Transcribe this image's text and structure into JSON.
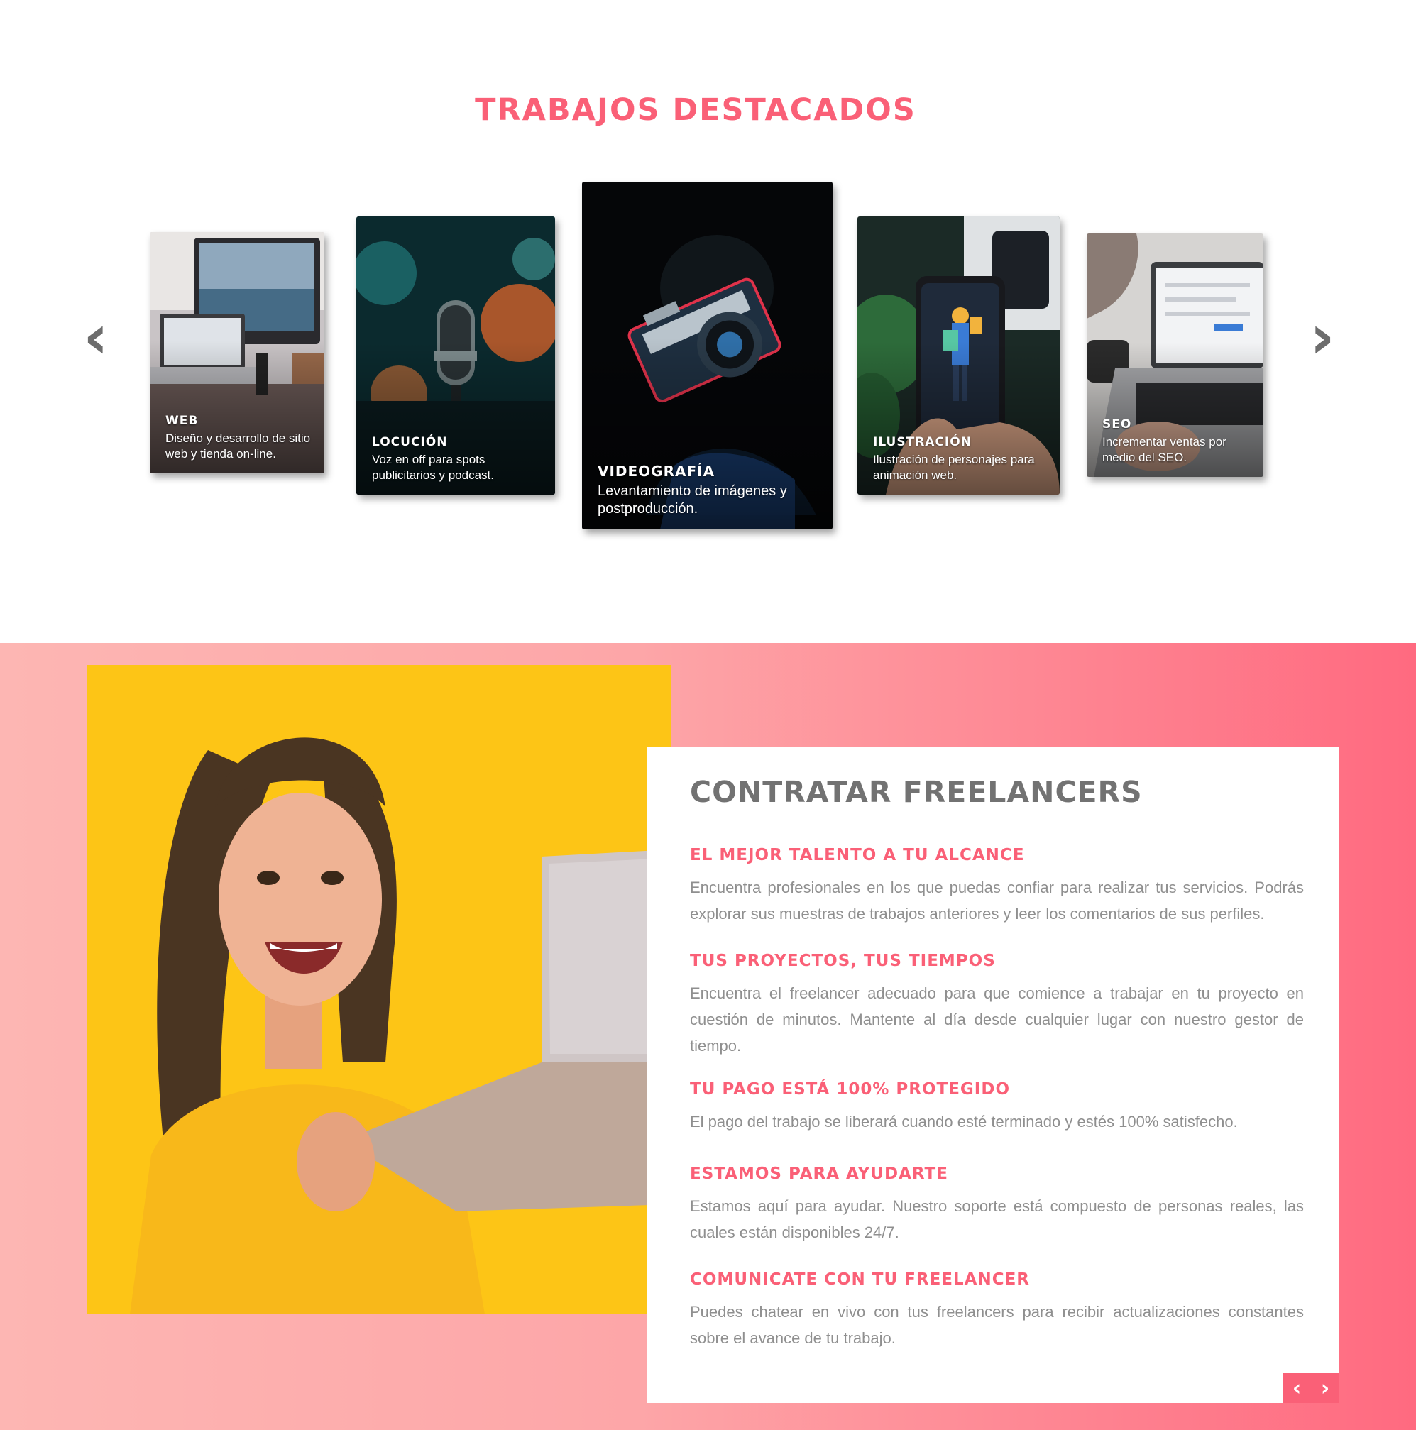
{
  "featured": {
    "title": "TRABAJOS DESTACADOS",
    "prev_icon": "chevron-left-icon",
    "next_icon": "chevron-right-icon",
    "cards": [
      {
        "title": "WEB",
        "desc": "Diseño y desarrollo de sitio web y tienda on-line."
      },
      {
        "title": "LOCUCIÓN",
        "desc": "Voz en off para spots publicitarios y podcast."
      },
      {
        "title": "VIDEOGRAFÍA",
        "desc": "Levantamiento de imágenes y postproducción."
      },
      {
        "title": "ILUSTRACIÓN",
        "desc": "Ilustración de personajes para animación web."
      },
      {
        "title": "SEO",
        "desc": "Incrementar ventas por medio del SEO."
      }
    ]
  },
  "hire": {
    "title": "CONTRATAR FREELANCERS",
    "features": [
      {
        "title": "EL MEJOR TALENTO A TU ALCANCE",
        "text": "Encuentra profesionales en los que puedas confiar para realizar tus servicios. Podrás explorar sus muestras de trabajos anteriores y leer los comentarios de sus perfiles."
      },
      {
        "title": "TUS PROYECTOS, TUS TIEMPOS",
        "text": "Encuentra el freelancer adecuado para que comience a trabajar en tu proyecto en cuestión de minutos. Mantente al día desde cualquier lugar con nuestro gestor de tiempo."
      },
      {
        "title": "TU PAGO ESTÁ 100% PROTEGIDO",
        "text": "El pago del trabajo se liberará cuando esté terminado y estés 100% satisfecho."
      },
      {
        "title": "ESTAMOS PARA AYUDARTE",
        "text": "Estamos aquí para ayudar. Nuestro soporte está compuesto de personas reales, las cuales están disponibles 24/7."
      },
      {
        "title": "COMUNICATE CON TU FREELANCER",
        "text": "Puedes chatear en vivo con tus freelancers para recibir actualizaciones constantes sobre el avance de tu trabajo."
      }
    ]
  },
  "colors": {
    "accent": "#fa6077",
    "heading_gray": "#727272",
    "body_gray": "#8f8f8f",
    "photo_yellow": "#fcc015"
  }
}
